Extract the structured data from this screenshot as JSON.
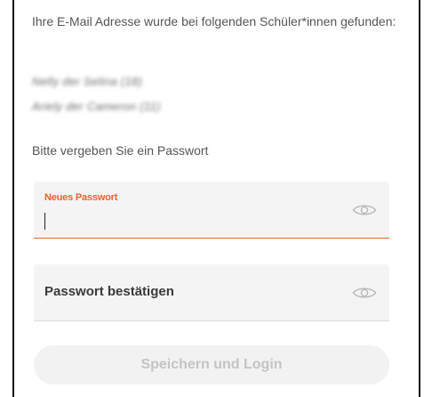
{
  "intro_text": "Ihre E-Mail Adresse wurde bei folgenden Schüler*innen gefunden:",
  "students": [
    {
      "label": "Nelly der Selina (18)"
    },
    {
      "label": "Ariely der Cameron (11)"
    }
  ],
  "password_prompt": "Bitte vergeben Sie ein Passwort",
  "new_password": {
    "label": "Neues Passwort",
    "value": "",
    "toggle_icon": "eye-icon"
  },
  "confirm_password": {
    "label": "Passwort bestätigen",
    "value": "",
    "toggle_icon": "eye-icon"
  },
  "submit_label": "Speichern und Login",
  "colors": {
    "accent": "#f0602f",
    "field_bg": "#f4f4f5",
    "button_bg_disabled": "#f2f2f3",
    "button_text_disabled": "#c4c4c6"
  }
}
